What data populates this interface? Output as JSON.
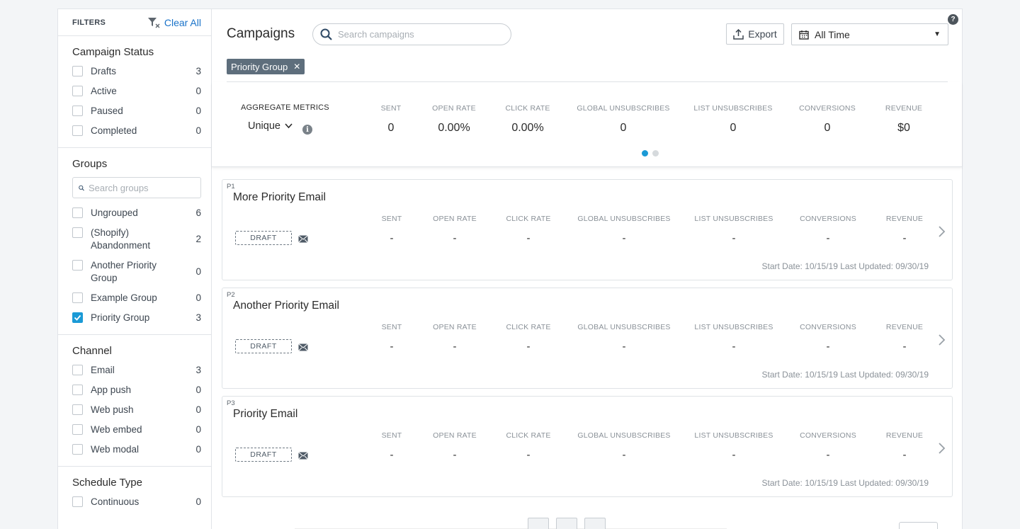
{
  "filters": {
    "title": "FILTERS",
    "clear_all": "Clear All",
    "campaign_status": {
      "title": "Campaign Status",
      "options": [
        {
          "label": "Drafts",
          "count": "3",
          "checked": false
        },
        {
          "label": "Active",
          "count": "0",
          "checked": false
        },
        {
          "label": "Paused",
          "count": "0",
          "checked": false
        },
        {
          "label": "Completed",
          "count": "0",
          "checked": false
        }
      ]
    },
    "groups": {
      "title": "Groups",
      "search_placeholder": "Search groups",
      "options": [
        {
          "label": "Ungrouped",
          "count": "6",
          "checked": false
        },
        {
          "label": "(Shopify) Abandonment",
          "count": "2",
          "checked": false
        },
        {
          "label": "Another Priority Group",
          "count": "0",
          "checked": false
        },
        {
          "label": "Example Group",
          "count": "0",
          "checked": false
        },
        {
          "label": "Priority Group",
          "count": "3",
          "checked": true
        }
      ]
    },
    "channel": {
      "title": "Channel",
      "options": [
        {
          "label": "Email",
          "count": "3",
          "checked": false
        },
        {
          "label": "App push",
          "count": "0",
          "checked": false
        },
        {
          "label": "Web push",
          "count": "0",
          "checked": false
        },
        {
          "label": "Web embed",
          "count": "0",
          "checked": false
        },
        {
          "label": "Web modal",
          "count": "0",
          "checked": false
        }
      ]
    },
    "schedule_type": {
      "title": "Schedule Type",
      "options": [
        {
          "label": "Continuous",
          "count": "0",
          "checked": false
        }
      ]
    }
  },
  "header": {
    "title": "Campaigns",
    "search_placeholder": "Search campaigns",
    "export_label": "Export",
    "date_range": "All Time",
    "help": "?"
  },
  "active_filter_chip": "Priority Group",
  "aggregate": {
    "label": "AGGREGATE METRICS",
    "mode": "Unique",
    "info": "i",
    "metrics": [
      {
        "label": "SENT",
        "value": "0"
      },
      {
        "label": "OPEN RATE",
        "value": "0.00%"
      },
      {
        "label": "CLICK RATE",
        "value": "0.00%"
      },
      {
        "label": "GLOBAL UNSUBSCRIBES",
        "value": "0"
      },
      {
        "label": "LIST UNSUBSCRIBES",
        "value": "0"
      },
      {
        "label": "CONVERSIONS",
        "value": "0"
      },
      {
        "label": "REVENUE",
        "value": "$0"
      }
    ],
    "pages": 2,
    "active_page": 1
  },
  "campaigns": [
    {
      "priority": "P1",
      "name": "More Priority Email",
      "status": "DRAFT",
      "metrics": [
        "-",
        "-",
        "-",
        "-",
        "-",
        "-",
        "-"
      ],
      "dates": "Start Date: 10/15/19   Last Updated: 09/30/19"
    },
    {
      "priority": "P2",
      "name": "Another Priority Email",
      "status": "DRAFT",
      "metrics": [
        "-",
        "-",
        "-",
        "-",
        "-",
        "-",
        "-"
      ],
      "dates": "Start Date: 10/15/19   Last Updated: 09/30/19"
    },
    {
      "priority": "P3",
      "name": "Priority Email",
      "status": "DRAFT",
      "metrics": [
        "-",
        "-",
        "-",
        "-",
        "-",
        "-",
        "-"
      ],
      "dates": "Start Date: 10/15/19   Last Updated: 09/30/19"
    }
  ],
  "metric_labels": [
    "SENT",
    "OPEN RATE",
    "CLICK RATE",
    "GLOBAL UNSUBSCRIBES",
    "LIST UNSUBSCRIBES",
    "CONVERSIONS",
    "REVENUE"
  ],
  "colors": {
    "accent": "#1b9ad6",
    "link": "#1a73c9",
    "chip": "#5e6e7c"
  }
}
